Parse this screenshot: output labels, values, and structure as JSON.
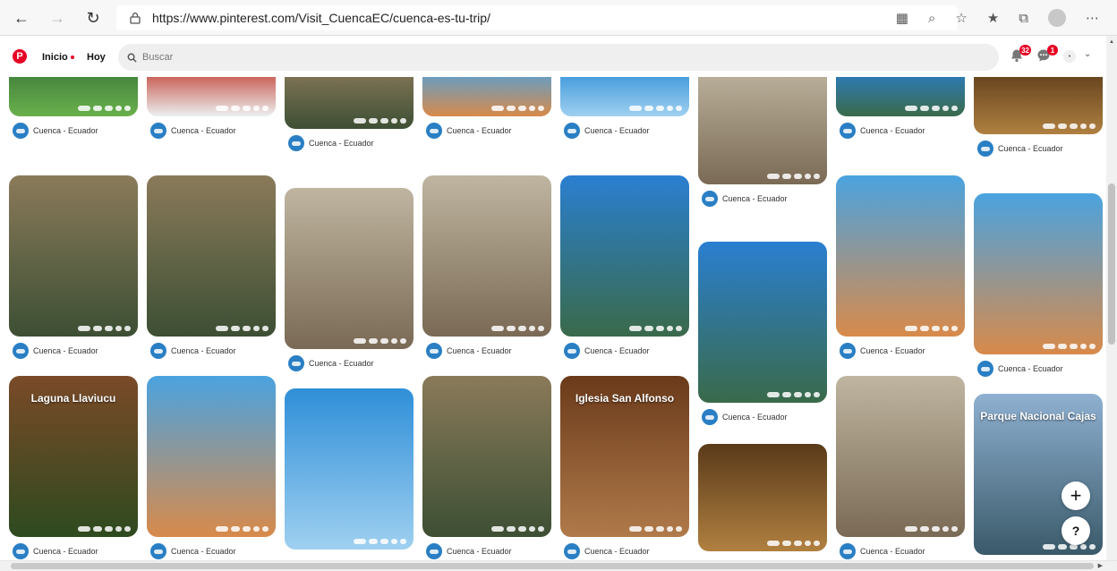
{
  "browser": {
    "url": "https://www.pinterest.com/Visit_CuencaEC/cuenca-es-tu-trip/"
  },
  "header": {
    "tab_home": "Inicio",
    "tab_today": "Hoy",
    "search_placeholder": "Buscar",
    "notifications_badge": "32",
    "messages_badge": "1"
  },
  "pin_caption": "Cuenca - Ecuador",
  "pins": [
    {
      "title": "",
      "color_top": "#3c7a3a",
      "color_bottom": "#6ab04c"
    },
    {
      "title": "",
      "color_top": "#c0392b",
      "color_bottom": "#ecf0f1"
    },
    {
      "title": "",
      "color_top": "#8a7a5a",
      "color_bottom": "#3d4f34"
    },
    {
      "title": "",
      "color_top": "#4aa3e0",
      "color_bottom": "#d88a4a"
    },
    {
      "title": "",
      "color_top": "#2f8fd8",
      "color_bottom": "#9fd0f0"
    },
    {
      "title": "",
      "color_top": "#bfb5a0",
      "color_bottom": "#7a6a55"
    },
    {
      "title": "",
      "color_top": "#2a7fd0",
      "color_bottom": "#3a6a4a"
    },
    {
      "title": "",
      "color_top": "#5a3a1a",
      "color_bottom": "#b08040"
    },
    {
      "title": "Laguna Llaviucu",
      "color_top": "#7a4a28",
      "color_bottom": "#2e4a1f"
    },
    {
      "title": "Parque Nacional Cajas",
      "color_top": "#8fb0d0",
      "color_bottom": "#3a5a6a"
    },
    {
      "title": "Iglesia San Alfonso",
      "color_top": "#6a3a1a",
      "color_bottom": "#b07a4a"
    }
  ]
}
